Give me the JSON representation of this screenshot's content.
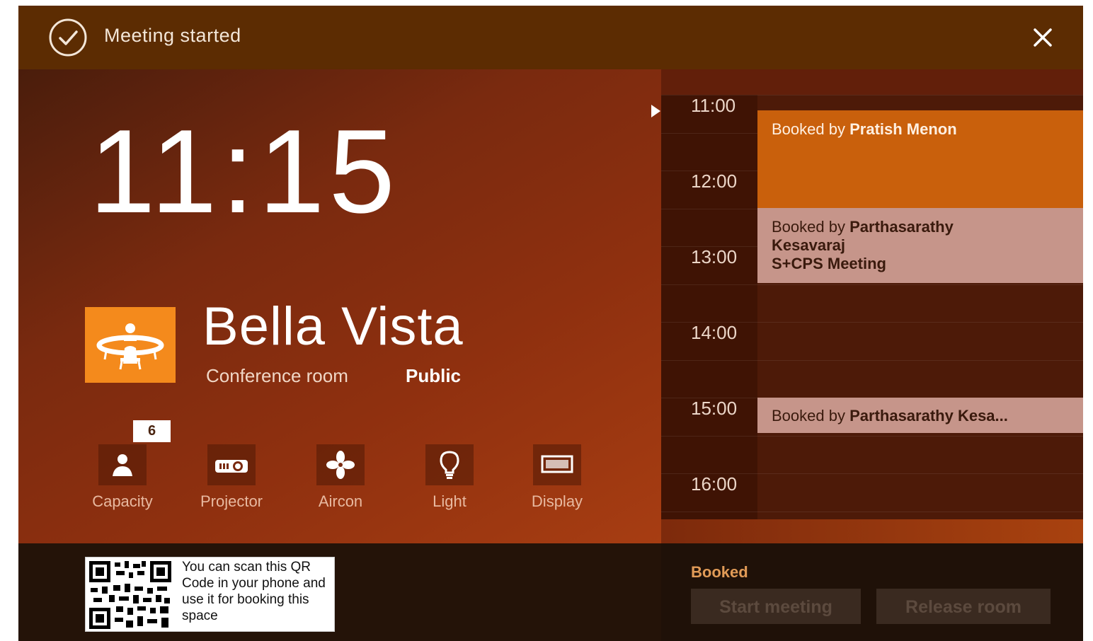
{
  "notification": {
    "message": "Meeting started",
    "icon": "check-circle-icon",
    "close_icon": "close-icon"
  },
  "clock": {
    "time": "11:15"
  },
  "room": {
    "name": "Bella Vista",
    "type": "Conference room",
    "access": "Public",
    "icon": "conference-table-icon",
    "icon_color": "#f48a1c"
  },
  "amenities": {
    "capacity": {
      "label": "Capacity",
      "badge": "6",
      "icon": "person-icon"
    },
    "projector": {
      "label": "Projector",
      "icon": "projector-icon"
    },
    "aircon": {
      "label": "Aircon",
      "icon": "fan-icon"
    },
    "light": {
      "label": "Light",
      "icon": "lightbulb-icon"
    },
    "display": {
      "label": "Display",
      "icon": "monitor-icon"
    }
  },
  "schedule": {
    "hours": [
      "11:00",
      "12:00",
      "13:00",
      "14:00",
      "15:00",
      "16:00"
    ],
    "bookings": [
      {
        "prefix": "Booked by",
        "name": "Pratish Menon",
        "title": "",
        "color": "#c9600c"
      },
      {
        "prefix": "Booked by",
        "name": "Parthasarathy",
        "name_cont": "Kesavaraj",
        "title": "S+CPS Meeting",
        "color": "#c6958a"
      },
      {
        "prefix": "Booked by",
        "name": "Parthasarathy Kesa...",
        "title": "",
        "color": "#c6958a"
      }
    ]
  },
  "qr": {
    "text": "You can scan this QR Code in your phone and use it for booking this space"
  },
  "footer": {
    "status": "Booked",
    "start_button": "Start meeting",
    "release_button": "Release room"
  },
  "colors": {
    "accent": "#f48a1c",
    "header": "#5c2c02",
    "status": "#e19b57"
  }
}
